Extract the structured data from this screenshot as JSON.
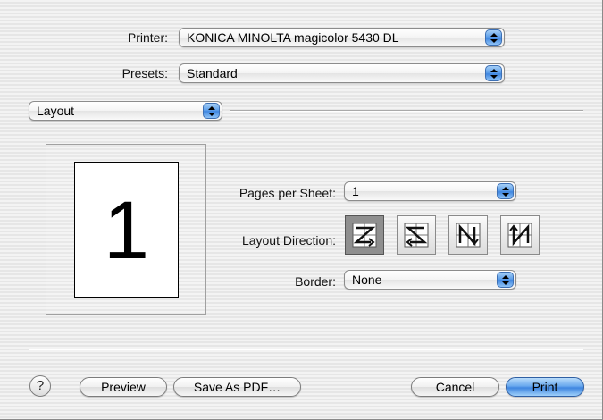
{
  "printer": {
    "label": "Printer:",
    "value": "KONICA MINOLTA magicolor 5430 DL"
  },
  "presets": {
    "label": "Presets:",
    "value": "Standard"
  },
  "panel_selector": {
    "value": "Layout"
  },
  "preview": {
    "page_number": "1"
  },
  "pages_per_sheet": {
    "label": "Pages per Sheet:",
    "value": "1"
  },
  "layout_direction": {
    "label": "Layout Direction:",
    "options": [
      {
        "icon": "z-order-left-to-right-icon",
        "selected": true
      },
      {
        "icon": "s-order-right-to-left-icon",
        "selected": false
      },
      {
        "icon": "n-order-top-to-bottom-reversed-icon",
        "selected": false
      },
      {
        "icon": "n-order-top-to-bottom-icon",
        "selected": false
      }
    ]
  },
  "border": {
    "label": "Border:",
    "value": "None"
  },
  "buttons": {
    "help": "?",
    "preview": "Preview",
    "save_pdf": "Save As PDF…",
    "cancel": "Cancel",
    "print": "Print"
  },
  "colors": {
    "accent": "#3f86e0",
    "selected_direction": "#8f8f8f"
  }
}
